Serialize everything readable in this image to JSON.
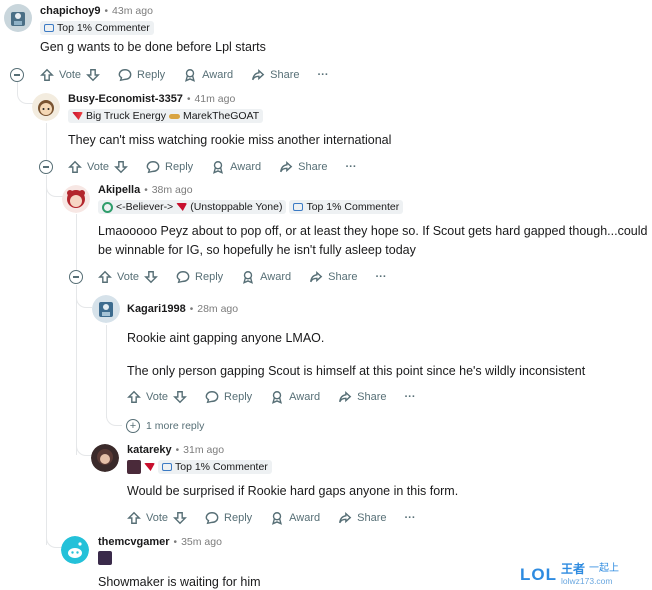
{
  "comments": [
    {
      "username": "chapichoy9",
      "time": "43m ago",
      "flair": "Top 1% Commenter",
      "body": "Gen g wants to be done before Lpl starts"
    },
    {
      "username": "Busy-Economist-3357",
      "time": "41m ago",
      "flair": "Big Truck Energy",
      "flair2": "MarekTheGOAT",
      "body": "They can't miss watching rookie miss another international"
    },
    {
      "username": "Akipella",
      "time": "38m ago",
      "flair": "<-Believer->",
      "flair2": "(Unstoppable Yone)",
      "flair3": "Top 1% Commenter",
      "body": "Lmaooooo Peyz about to pop off, or at least they hope so. If Scout gets hard gapped though...could be winnable for IG, so hopefully he isn't fully asleep today"
    },
    {
      "username": "Kagari1998",
      "time": "28m ago",
      "body": "Rookie aint gapping anyone LMAO.",
      "body2": "The only person gapping Scout is himself at this point since he's wildly inconsistent"
    },
    {
      "username": "katareky",
      "time": "31m ago",
      "flair": "Top 1% Commenter",
      "body": "Would be surprised if Rookie hard gaps anyone in this form."
    },
    {
      "username": "themcvgamer",
      "time": "35m ago",
      "body": "Showmaker is waiting for him"
    }
  ],
  "actions": {
    "vote": "Vote",
    "reply": "Reply",
    "award": "Award",
    "share": "Share",
    "more": "···"
  },
  "more_replies": "1 more reply",
  "separator": "•",
  "watermark": {
    "lol": "LOL",
    "cn": "王者",
    "cn2": "一起上",
    "url": "lolwz173.com"
  }
}
